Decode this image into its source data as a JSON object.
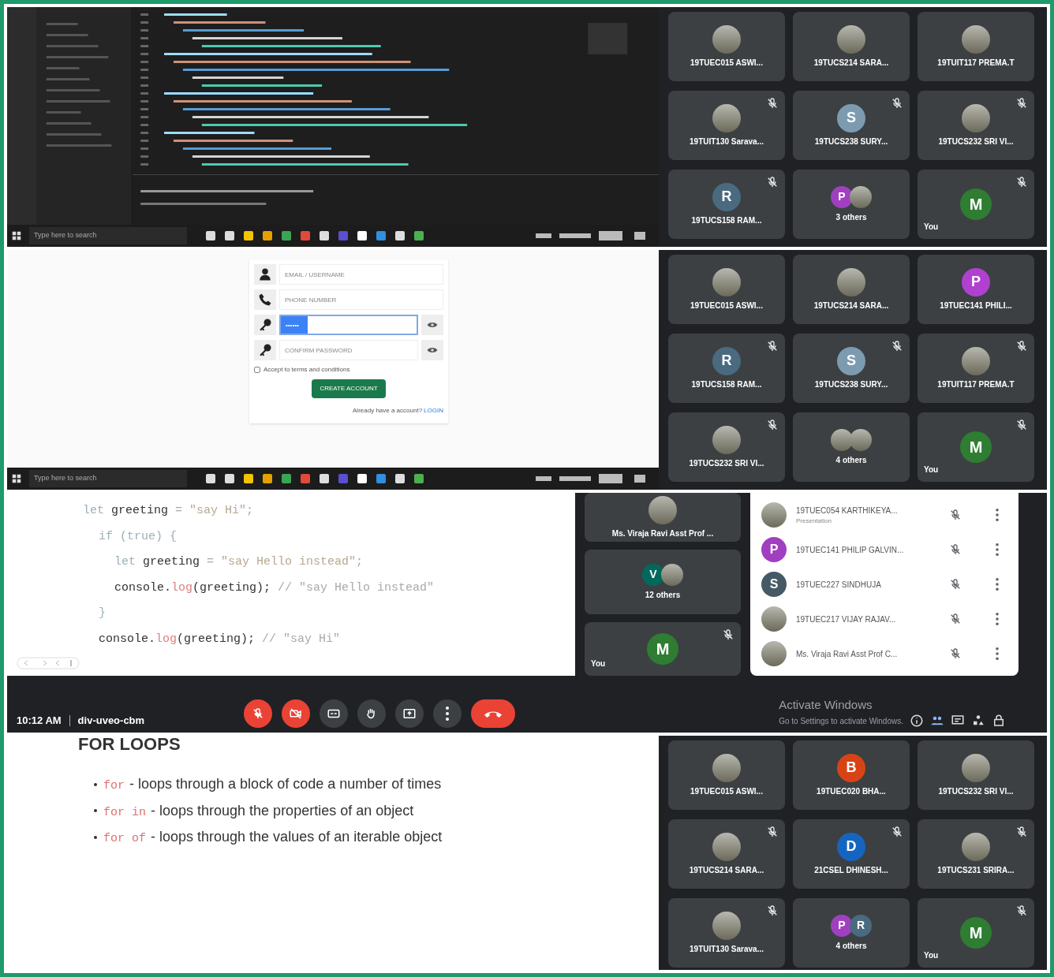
{
  "screens": [
    {
      "kind": "editor",
      "taskbar": {
        "search": "Type here to search"
      },
      "tiles": [
        {
          "kind": "person",
          "name": "19TUEC015 ASWI...",
          "muted": false,
          "avatar": {
            "kind": "photo"
          }
        },
        {
          "kind": "person",
          "name": "19TUCS214 SARA...",
          "muted": false,
          "avatar": {
            "kind": "photo"
          }
        },
        {
          "kind": "person",
          "name": "19TUIT117 PREMA.T",
          "muted": false,
          "avatar": {
            "kind": "photo"
          }
        },
        {
          "kind": "person",
          "name": "19TUIT130 Sarava...",
          "muted": true,
          "avatar": {
            "kind": "photo"
          }
        },
        {
          "kind": "person",
          "name": "19TUCS238 SURY...",
          "muted": true,
          "avatar": {
            "kind": "letter",
            "letter": "S",
            "color": "#7d9bb0"
          }
        },
        {
          "kind": "person",
          "name": "19TUCS232 SRI VI...",
          "muted": true,
          "avatar": {
            "kind": "photo"
          }
        },
        {
          "kind": "person",
          "name": "19TUCS158 RAM...",
          "muted": true,
          "avatar": {
            "kind": "letter",
            "letter": "R",
            "color": "#4a6a80"
          }
        },
        {
          "kind": "group",
          "name": "3 others",
          "muted": false,
          "avatars": [
            {
              "kind": "letter",
              "letter": "P",
              "color": "#a040c0"
            },
            {
              "kind": "photo"
            }
          ]
        },
        {
          "kind": "self",
          "name": "You",
          "muted": true,
          "avatar": {
            "kind": "letter",
            "letter": "M",
            "color": "#2e7d32"
          }
        }
      ]
    },
    {
      "kind": "signup_form",
      "taskbar": {
        "search": "Type here to search"
      },
      "form": {
        "fields": [
          {
            "kind": "username",
            "placeholder": "EMAIL / USERNAME",
            "focused": false,
            "reveal": false
          },
          {
            "kind": "phone",
            "placeholder": "PHONE NUMBER",
            "focused": false,
            "reveal": false
          },
          {
            "kind": "password",
            "value": "••••••",
            "focused": true,
            "reveal": true
          },
          {
            "kind": "password",
            "placeholder": "CONFIRM PASSWORD",
            "focused": false,
            "reveal": true
          }
        ],
        "terms": {
          "label": "Accept to terms and conditions",
          "checked": false
        },
        "submit": "CREATE ACCOUNT",
        "footer": "Already have a account?",
        "link": "LOGIN"
      },
      "tiles": [
        {
          "kind": "person",
          "name": "19TUEC015 ASWI...",
          "muted": false,
          "avatar": {
            "kind": "photo"
          }
        },
        {
          "kind": "person",
          "name": "19TUCS214 SARA...",
          "muted": false,
          "avatar": {
            "kind": "photo"
          }
        },
        {
          "kind": "person",
          "name": "19TUEC141 PHILI...",
          "muted": false,
          "avatar": {
            "kind": "letter",
            "letter": "P",
            "color": "#b040d0"
          }
        },
        {
          "kind": "person",
          "name": "19TUCS158 RAM...",
          "muted": true,
          "avatar": {
            "kind": "letter",
            "letter": "R",
            "color": "#4a6a80"
          }
        },
        {
          "kind": "person",
          "name": "19TUCS238 SURY...",
          "muted": true,
          "avatar": {
            "kind": "letter",
            "letter": "S",
            "color": "#7d9bb0"
          }
        },
        {
          "kind": "person",
          "name": "19TUIT117 PREMA.T",
          "muted": true,
          "avatar": {
            "kind": "photo"
          }
        },
        {
          "kind": "person",
          "name": "19TUCS232 SRI VI...",
          "muted": true,
          "avatar": {
            "kind": "photo"
          }
        },
        {
          "kind": "group",
          "name": "4 others",
          "muted": false,
          "avatars": [
            {
              "kind": "photo"
            },
            {
              "kind": "photo"
            }
          ]
        },
        {
          "kind": "self",
          "name": "You",
          "muted": true,
          "avatar": {
            "kind": "letter",
            "letter": "M",
            "color": "#2e7d32"
          }
        }
      ]
    },
    {
      "kind": "meet_presentation",
      "code": [
        {
          "tokens": [
            {
              "kind": "kw",
              "text": "let"
            },
            {
              "kind": "plain",
              "text": " greeting "
            },
            {
              "kind": "op",
              "text": "="
            },
            {
              "kind": "str",
              "text": " \"say Hi\";"
            }
          ],
          "children": [
            {
              "tokens": [
                {
                  "kind": "kw",
                  "text": "if (true) {"
                }
              ],
              "children": [
                {
                  "tokens": [
                    {
                      "kind": "kw",
                      "text": "let"
                    },
                    {
                      "kind": "plain",
                      "text": " greeting "
                    },
                    {
                      "kind": "op",
                      "text": "="
                    },
                    {
                      "kind": "str",
                      "text": " \"say Hello instead\";"
                    }
                  ]
                },
                {
                  "tokens": [
                    {
                      "kind": "plain",
                      "text": "console."
                    },
                    {
                      "kind": "fn",
                      "text": "log"
                    },
                    {
                      "kind": "plain",
                      "text": "(greeting);"
                    },
                    {
                      "kind": "comment",
                      "text": " // \"say Hello instead\""
                    }
                  ]
                }
              ]
            },
            {
              "tokens": [
                {
                  "kind": "kw",
                  "text": "}"
                }
              ]
            },
            {
              "tokens": [
                {
                  "kind": "plain",
                  "text": "console."
                },
                {
                  "kind": "fn",
                  "text": "log"
                },
                {
                  "kind": "plain",
                  "text": "(greeting);"
                },
                {
                  "kind": "comment",
                  "text": " // \"say Hi\""
                }
              ]
            }
          ]
        }
      ],
      "tiles": [
        {
          "kind": "person",
          "name": "Ms. Viraja Ravi Asst Prof ...",
          "muted": false,
          "avatar": {
            "kind": "photo"
          }
        },
        {
          "kind": "group",
          "name": "12 others",
          "muted": false,
          "avatars": [
            {
              "kind": "letter",
              "letter": "V",
              "color": "#00695c"
            },
            {
              "kind": "photo"
            }
          ]
        },
        {
          "kind": "self",
          "name": "You",
          "muted": true,
          "avatar": {
            "kind": "letter",
            "letter": "M",
            "color": "#2e7d32"
          }
        }
      ],
      "participants": [
        {
          "name": "19TUEC054 KARTHIKEYA...",
          "subtitle": "Presentation",
          "muted": true,
          "avatar": {
            "kind": "photo"
          }
        },
        {
          "name": "19TUEC141 PHILIP GALVIN...",
          "muted": true,
          "avatar": {
            "kind": "letter",
            "letter": "P",
            "color": "#a040c0"
          }
        },
        {
          "name": "19TUEC227 SINDHUJA",
          "muted": true,
          "avatar": {
            "kind": "letter",
            "letter": "S",
            "color": "#455a64"
          }
        },
        {
          "name": "19TUEC217 VIJAY RAJAV...",
          "muted": true,
          "avatar": {
            "kind": "photo"
          }
        },
        {
          "name": "Ms. Viraja Ravi Asst Prof C...",
          "muted": true,
          "avatar": {
            "kind": "photo"
          }
        }
      ],
      "time": "10:12 AM",
      "meeting_code": "div-uveo-cbm",
      "controls": [
        {
          "kind": "mic",
          "off": true
        },
        {
          "kind": "camera",
          "off": true
        },
        {
          "kind": "captions",
          "off": false
        },
        {
          "kind": "hand",
          "off": false
        },
        {
          "kind": "present",
          "off": false
        },
        {
          "kind": "more",
          "off": false
        },
        {
          "kind": "hangup"
        }
      ],
      "activation": [
        "Activate Windows",
        "Go to Settings to activate Windows."
      ]
    },
    {
      "kind": "slide",
      "title": "FOR LOOPS",
      "bullets": [
        {
          "keyword": "for",
          "text": "- loops through a block of code a number of times"
        },
        {
          "keyword": "for in",
          "text": "- loops through the properties of an object"
        },
        {
          "keyword": "for of",
          "text": "- loops through the values of an iterable object"
        }
      ],
      "tiles": [
        {
          "kind": "person",
          "name": "19TUEC015 ASWI...",
          "muted": false,
          "avatar": {
            "kind": "photo"
          }
        },
        {
          "kind": "person",
          "name": "19TUEC020 BHA...",
          "muted": false,
          "avatar": {
            "kind": "letter",
            "letter": "B",
            "color": "#d84315"
          }
        },
        {
          "kind": "person",
          "name": "19TUCS232 SRI VI...",
          "muted": false,
          "avatar": {
            "kind": "photo"
          }
        },
        {
          "kind": "person",
          "name": "19TUCS214 SARA...",
          "muted": true,
          "avatar": {
            "kind": "photo"
          }
        },
        {
          "kind": "person",
          "name": "21CSEL DHINESH...",
          "muted": true,
          "avatar": {
            "kind": "letter",
            "letter": "D",
            "color": "#1565c0"
          }
        },
        {
          "kind": "person",
          "name": "19TUCS231 SRIRA...",
          "muted": true,
          "avatar": {
            "kind": "photo"
          }
        },
        {
          "kind": "person",
          "name": "19TUIT130 Sarava...",
          "muted": true,
          "avatar": {
            "kind": "photo"
          }
        },
        {
          "kind": "group",
          "name": "4 others",
          "muted": false,
          "avatars": [
            {
              "kind": "letter",
              "letter": "P",
              "color": "#a040c0"
            },
            {
              "kind": "letter",
              "letter": "R",
              "color": "#4a6a80"
            }
          ]
        },
        {
          "kind": "self",
          "name": "You",
          "muted": true,
          "avatar": {
            "kind": "letter",
            "letter": "M",
            "color": "#2e7d32"
          }
        }
      ]
    }
  ]
}
